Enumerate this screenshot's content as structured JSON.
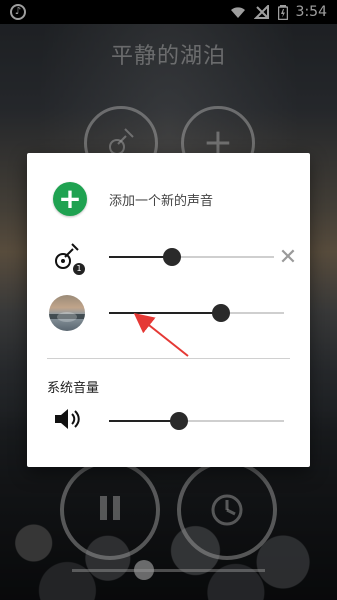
{
  "statusbar": {
    "time": "3:54",
    "left_icon": "music-note-icon",
    "right_icons": [
      "wifi-icon",
      "no-signal-icon",
      "battery-icon"
    ]
  },
  "app": {
    "title": "平静的湖泊"
  },
  "dialog": {
    "add_sound_label": "添加一个新的声音",
    "rows": [
      {
        "icon": "guitar-icon",
        "badge": "1",
        "volume": 0.38,
        "removable": true
      },
      {
        "icon": "lake-thumbnail",
        "volume": 0.64,
        "removable": false
      }
    ],
    "system_volume_label": "系统音量",
    "system_volume": 0.4
  },
  "colors": {
    "fab_green": "#1fa251",
    "slider_fill": "#222222",
    "slider_track": "#cfcfcf",
    "annotation_red": "#e53935"
  }
}
